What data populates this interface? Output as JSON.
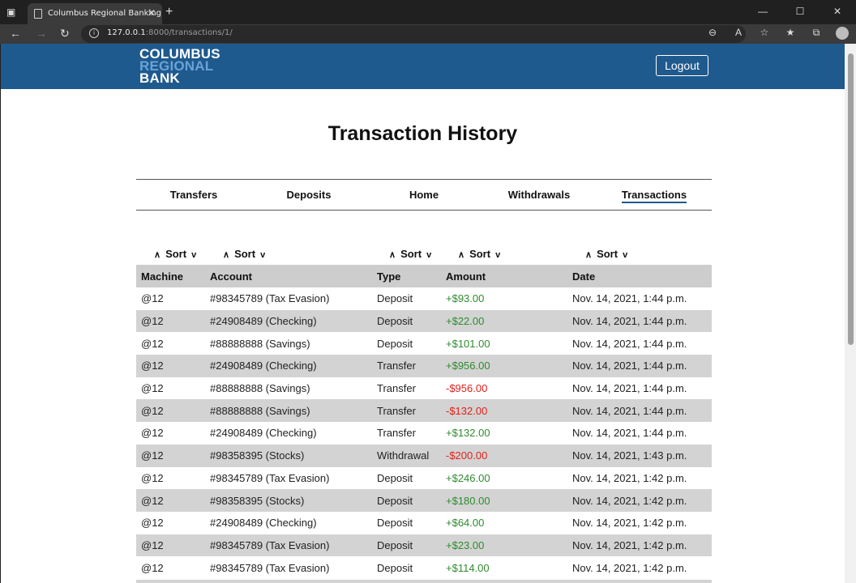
{
  "browser": {
    "tab_title": "Columbus Regional Banking",
    "url_host": "127.0.0.1",
    "url_path": ":8000/transactions/1/"
  },
  "header": {
    "logo_line1": "COLUMBUS",
    "logo_line2": "REGIONAL",
    "logo_line3": "BANK",
    "logout_label": "Logout"
  },
  "page": {
    "title": "Transaction History"
  },
  "nav": {
    "items": [
      "Transfers",
      "Deposits",
      "Home",
      "Withdrawals",
      "Transactions"
    ],
    "active": "Transactions"
  },
  "sort_label": "Sort",
  "table": {
    "headers": [
      "Machine",
      "Account",
      "Type",
      "Amount",
      "Date"
    ],
    "rows": [
      {
        "machine": "@12",
        "account": "#98345789 (Tax Evasion)",
        "type": "Deposit",
        "amount": "+$93.00",
        "date": "Nov. 14, 2021, 1:44 p.m.",
        "sign": "pos"
      },
      {
        "machine": "@12",
        "account": "#24908489 (Checking)",
        "type": "Deposit",
        "amount": "+$22.00",
        "date": "Nov. 14, 2021, 1:44 p.m.",
        "sign": "pos"
      },
      {
        "machine": "@12",
        "account": "#88888888 (Savings)",
        "type": "Deposit",
        "amount": "+$101.00",
        "date": "Nov. 14, 2021, 1:44 p.m.",
        "sign": "pos"
      },
      {
        "machine": "@12",
        "account": "#24908489 (Checking)",
        "type": "Transfer",
        "amount": "+$956.00",
        "date": "Nov. 14, 2021, 1:44 p.m.",
        "sign": "pos"
      },
      {
        "machine": "@12",
        "account": "#88888888 (Savings)",
        "type": "Transfer",
        "amount": "-$956.00",
        "date": "Nov. 14, 2021, 1:44 p.m.",
        "sign": "neg"
      },
      {
        "machine": "@12",
        "account": "#88888888 (Savings)",
        "type": "Transfer",
        "amount": "-$132.00",
        "date": "Nov. 14, 2021, 1:44 p.m.",
        "sign": "neg"
      },
      {
        "machine": "@12",
        "account": "#24908489 (Checking)",
        "type": "Transfer",
        "amount": "+$132.00",
        "date": "Nov. 14, 2021, 1:44 p.m.",
        "sign": "pos"
      },
      {
        "machine": "@12",
        "account": "#98358395 (Stocks)",
        "type": "Withdrawal",
        "amount": "-$200.00",
        "date": "Nov. 14, 2021, 1:43 p.m.",
        "sign": "neg"
      },
      {
        "machine": "@12",
        "account": "#98345789 (Tax Evasion)",
        "type": "Deposit",
        "amount": "+$246.00",
        "date": "Nov. 14, 2021, 1:42 p.m.",
        "sign": "pos"
      },
      {
        "machine": "@12",
        "account": "#98358395 (Stocks)",
        "type": "Deposit",
        "amount": "+$180.00",
        "date": "Nov. 14, 2021, 1:42 p.m.",
        "sign": "pos"
      },
      {
        "machine": "@12",
        "account": "#24908489 (Checking)",
        "type": "Deposit",
        "amount": "+$64.00",
        "date": "Nov. 14, 2021, 1:42 p.m.",
        "sign": "pos"
      },
      {
        "machine": "@12",
        "account": "#98345789 (Tax Evasion)",
        "type": "Deposit",
        "amount": "+$23.00",
        "date": "Nov. 14, 2021, 1:42 p.m.",
        "sign": "pos"
      },
      {
        "machine": "@12",
        "account": "#98345789 (Tax Evasion)",
        "type": "Deposit",
        "amount": "+$114.00",
        "date": "Nov. 14, 2021, 1:42 p.m.",
        "sign": "pos"
      }
    ]
  },
  "colors": {
    "header_bg": "#1f5a8e",
    "positive": "#2e8b2e",
    "negative": "#e0201a",
    "row_stripe": "#d3d3d3"
  }
}
